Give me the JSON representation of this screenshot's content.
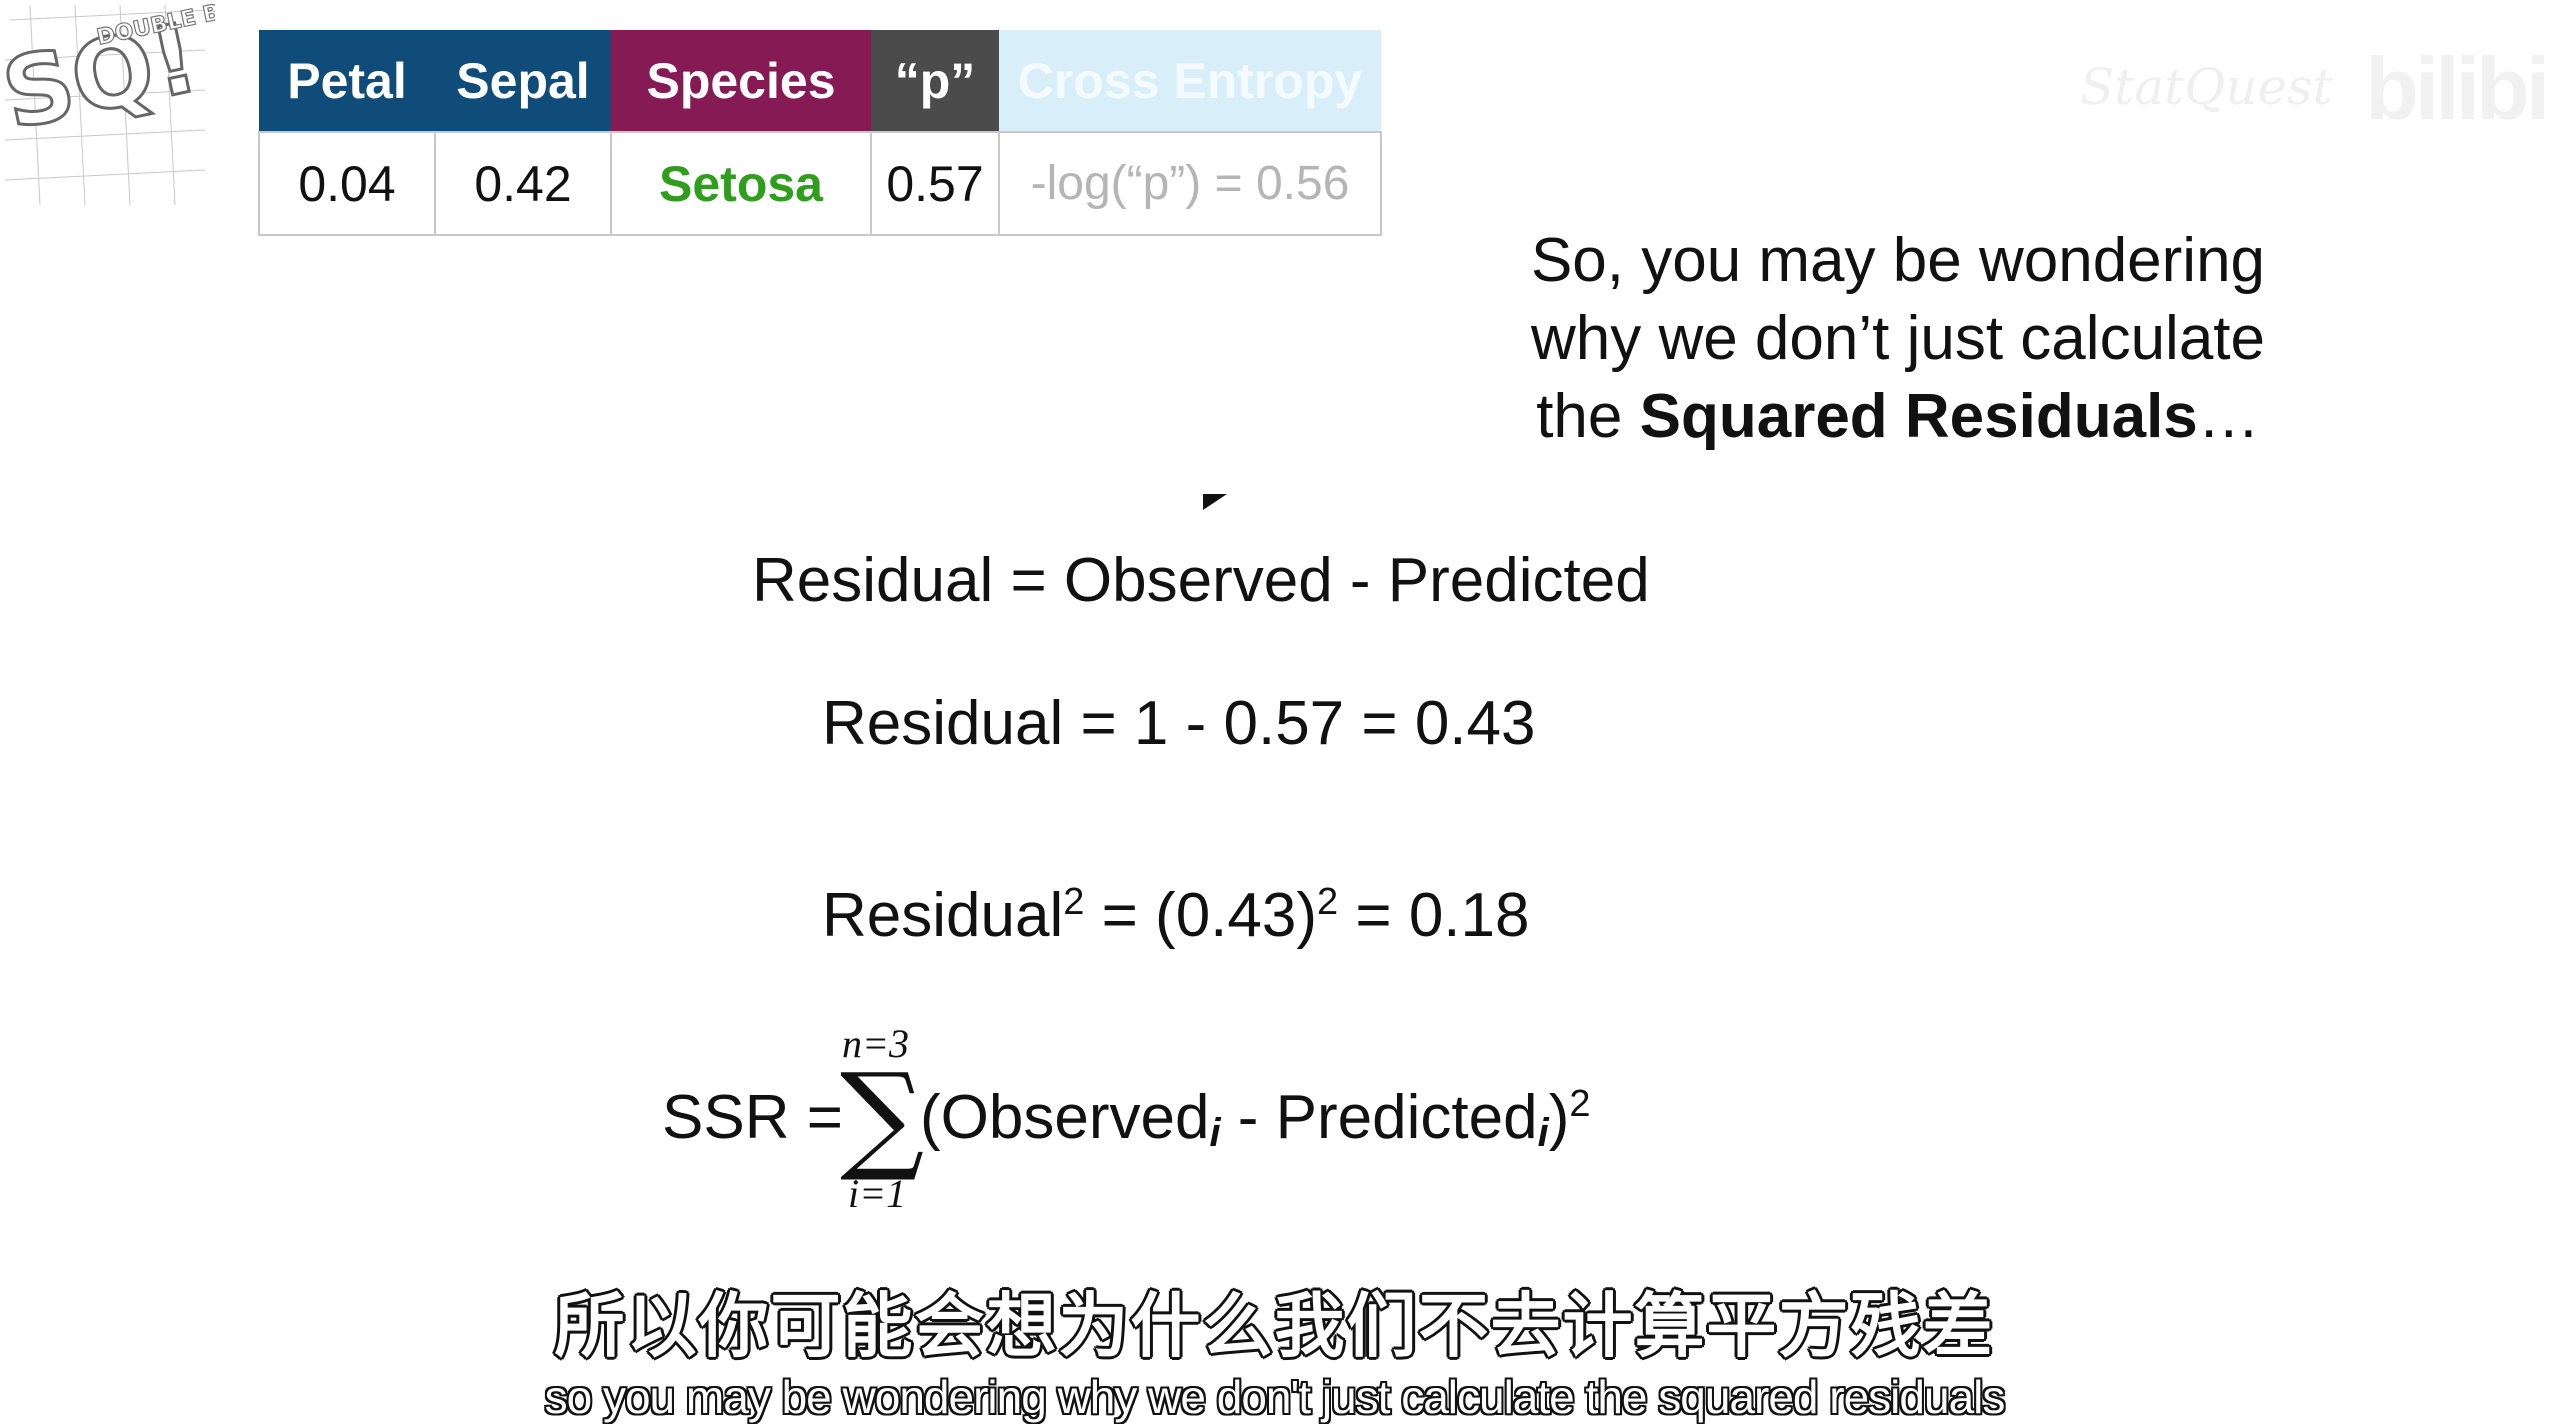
{
  "logo": {
    "main": "SQ!",
    "small": "DOUBLE BAM!!"
  },
  "watermark": {
    "text": "StatQuest",
    "brand": "bilibili"
  },
  "table": {
    "headers": {
      "petal": "Petal",
      "sepal": "Sepal",
      "species": "Species",
      "p": "“p”",
      "cross_entropy": "Cross Entropy"
    },
    "row": {
      "petal": "0.04",
      "sepal": "0.42",
      "species": "Setosa",
      "p": "0.57",
      "cross_entropy": "-log(“p”) = 0.56"
    }
  },
  "side_note": {
    "line1": "So, you may be wondering",
    "line2": "why we don’t just calculate",
    "line3_pre": "the ",
    "line3_bold": "Squared Residuals",
    "line3_post": "…"
  },
  "equations": {
    "eq1": "Residual = Observed - Predicted",
    "eq2": "Residual = 1 - 0.57 = 0.43",
    "eq3_a": "Residual",
    "eq3_b": "2",
    "eq3_c": " = (0.43)",
    "eq3_d": "2",
    "eq3_e": " = 0.18",
    "ssr_lhs": "SSR =",
    "ssr_sigma": "∑",
    "ssr_upper": "n=3",
    "ssr_lower": "i=1",
    "ssr_obs": "(Observed",
    "ssr_i1": "i",
    "ssr_mid": " - Predicted",
    "ssr_i2": "i",
    "ssr_close": ")",
    "ssr_sq": "2"
  },
  "subtitles": {
    "zh": "所以你可能会想为什么我们不去计算平方残差",
    "en": "so you may be wondering why we don't just calculate the squared residuals"
  }
}
